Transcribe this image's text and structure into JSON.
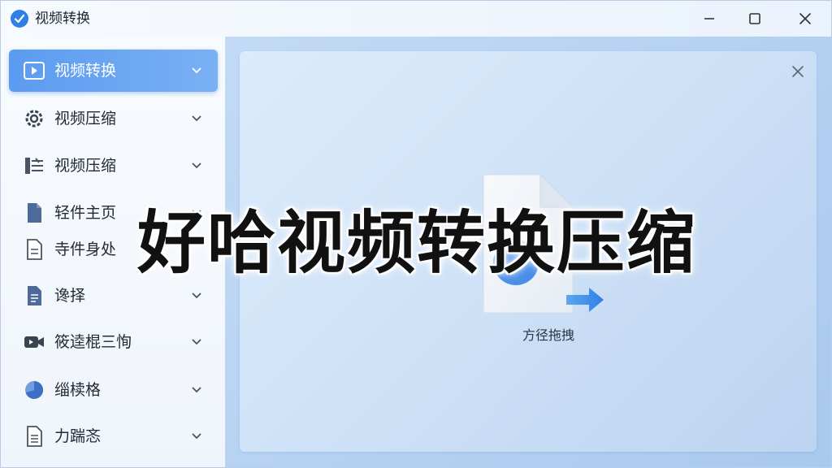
{
  "window": {
    "title": "视频转换",
    "accent": "#2f7fe6"
  },
  "sidebar": {
    "items": [
      {
        "label": "视频转换",
        "icon": "play-icon",
        "active": true
      },
      {
        "label": "视频压缩",
        "icon": "gear-icon",
        "active": false
      },
      {
        "label": "视频压缩",
        "icon": "compress-icon",
        "active": false
      },
      {
        "label": "轻件主页",
        "icon": "document-icon",
        "active": false
      },
      {
        "label": "寺件身处",
        "icon": "file-icon",
        "active": false
      },
      {
        "label": "谗择",
        "icon": "list-document-icon",
        "active": false
      },
      {
        "label": "筱逵棍三恂",
        "icon": "video-camera-icon",
        "active": false
      },
      {
        "label": "缁椟格",
        "icon": "pie-icon",
        "active": false
      },
      {
        "label": "力踹忞",
        "icon": "note-icon",
        "active": false
      }
    ]
  },
  "main": {
    "drop_label": "方径拖拽"
  },
  "banner": {
    "text": "好哈视频转换压缩"
  }
}
